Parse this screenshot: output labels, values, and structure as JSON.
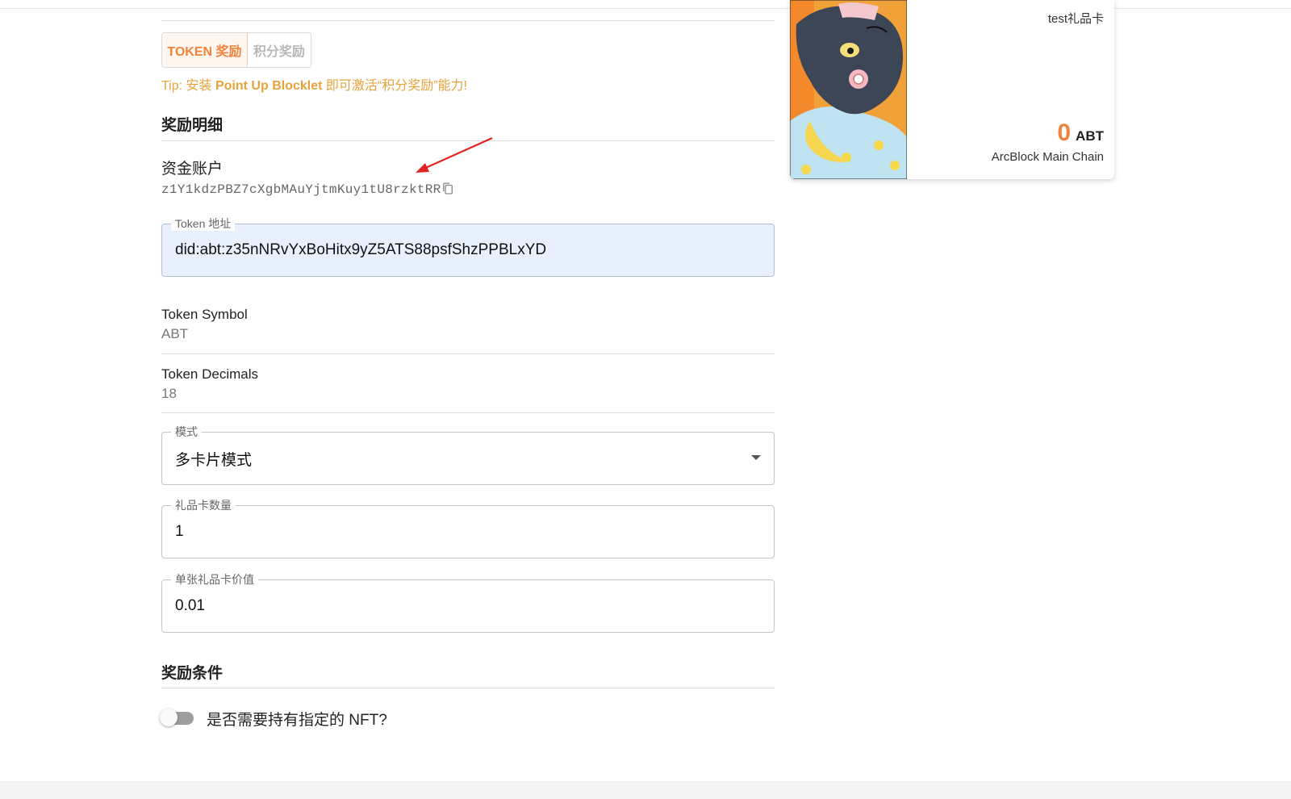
{
  "reward_type": {
    "tabs": [
      {
        "label": "TOKEN 奖励",
        "active": true
      },
      {
        "label": "积分奖励",
        "active": false
      }
    ],
    "tip_prefix": "Tip: 安装 ",
    "tip_strong": "Point Up Blocklet",
    "tip_suffix": " 即可激活“积分奖励”能力!"
  },
  "reward_detail": {
    "title": "奖励明细",
    "account_label": "资金账户",
    "account_address": "z1Y1kdzPBZ7cXgbMAuYjtmKuy1tU8rzktRR",
    "token_address": {
      "label": "Token 地址",
      "value": "did:abt:z35nNRvYxBoHitx9yZ5ATS88psfShzPPBLxYD"
    },
    "token_symbol": {
      "label": "Token Symbol",
      "value": "ABT"
    },
    "token_decimals": {
      "label": "Token Decimals",
      "value": "18"
    },
    "mode": {
      "label": "模式",
      "value": "多卡片模式"
    },
    "card_count": {
      "label": "礼品卡数量",
      "value": "1"
    },
    "card_value": {
      "label": "单张礼品卡价值",
      "value": "0.01"
    }
  },
  "reward_conditions": {
    "title": "奖励条件",
    "nft_required_label": "是否需要持有指定的 NFT?",
    "nft_required": false
  },
  "gift_card": {
    "name": "test礼品卡",
    "amount": "0",
    "symbol": "ABT",
    "chain": "ArcBlock Main Chain"
  },
  "colors": {
    "accent": "#f0833a",
    "tip": "#e8a23b",
    "annotation_arrow": "#e02424"
  },
  "icons": {
    "copy": "copy-icon",
    "select_arrow": "caret-down-icon"
  }
}
